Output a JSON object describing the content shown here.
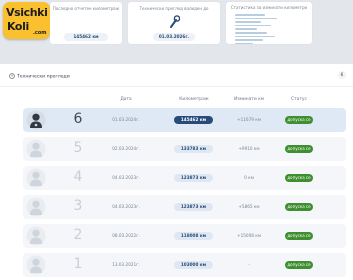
{
  "logo": {
    "line1": "Vsichki",
    "line2": "Koli",
    "line3": ".com"
  },
  "cards": {
    "mileage": {
      "title": "Последно отчетен километраж",
      "value": "145462 км"
    },
    "inspection": {
      "title": "Технически преглед валиден до",
      "value": "01.03.2026г."
    },
    "stats": {
      "title": "Статистика за изминати километри"
    }
  },
  "panel": {
    "title": "Технически прегледи",
    "count": "6"
  },
  "columns": {
    "date": "Дата",
    "mileage": "Километраж",
    "traveled": "Изминати км",
    "status": "Статус"
  },
  "rows": [
    {
      "num": "6",
      "date": "01.03.2024г.",
      "mileage": "145462 км",
      "traveled": "+11679 км",
      "status": "допуска се"
    },
    {
      "num": "5",
      "date": "02.03.2024г.",
      "mileage": "133783 км",
      "traveled": "+9910 км",
      "status": "допуска се"
    },
    {
      "num": "4",
      "date": "04.03.2023г.",
      "mileage": "123873 км",
      "traveled": "0 км",
      "status": "допуска се"
    },
    {
      "num": "3",
      "date": "04.03.2023г.",
      "mileage": "123873 км",
      "traveled": "+5865 км",
      "status": "допуска се"
    },
    {
      "num": "2",
      "date": "08.03.2022г.",
      "mileage": "118008 км",
      "traveled": "+15008 км",
      "status": "допуска се"
    },
    {
      "num": "1",
      "date": "13.03.2021г.",
      "mileage": "103000 км",
      "traveled": "-",
      "status": "допуска се"
    }
  ],
  "colors": {
    "navy": "#274b7a",
    "status_green": "#3e8f2f",
    "logo_yellow": "#fbc02d"
  },
  "icons": {
    "inspection": "wrench-icon",
    "avatar": "mechanic-avatar-icon",
    "panel": "clock-icon"
  }
}
